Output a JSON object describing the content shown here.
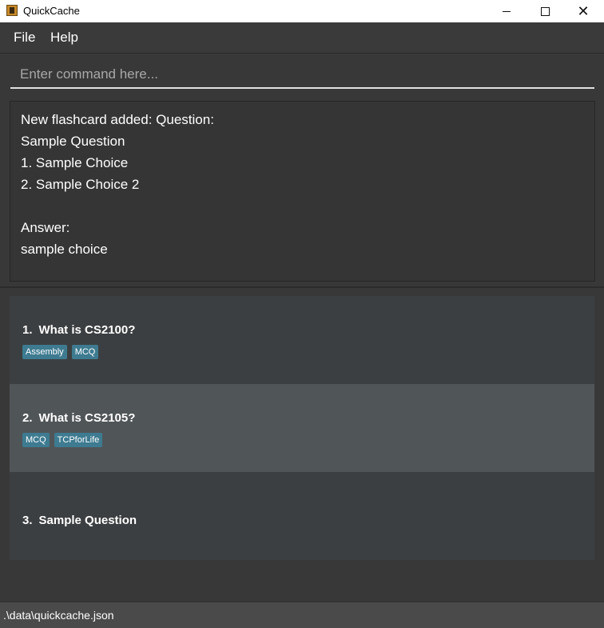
{
  "window": {
    "title": "QuickCache"
  },
  "menu": {
    "file": "File",
    "help": "Help"
  },
  "command": {
    "placeholder": "Enter command here...",
    "value": ""
  },
  "result": {
    "lines": [
      "New flashcard added: Question:",
      "Sample Question",
      "1. Sample Choice",
      "2. Sample Choice 2",
      "",
      "Answer:",
      "sample choice"
    ]
  },
  "flashcards": [
    {
      "index": "1.",
      "question": "What is CS2100?",
      "tags": [
        "Assembly",
        "MCQ"
      ],
      "selected": false
    },
    {
      "index": "2.",
      "question": "What is CS2105?",
      "tags": [
        "MCQ",
        "TCPforLife"
      ],
      "selected": true
    },
    {
      "index": "3.",
      "question": "Sample Question",
      "tags": [],
      "selected": false
    }
  ],
  "status": {
    "path": ".\\data\\quickcache.json"
  },
  "colors": {
    "background": "#383838",
    "card": "#3c3f41",
    "card_selected": "#505558",
    "tag": "#3e7b91"
  },
  "icons": [
    "app-icon",
    "minimize-icon",
    "maximize-icon",
    "close-icon"
  ]
}
